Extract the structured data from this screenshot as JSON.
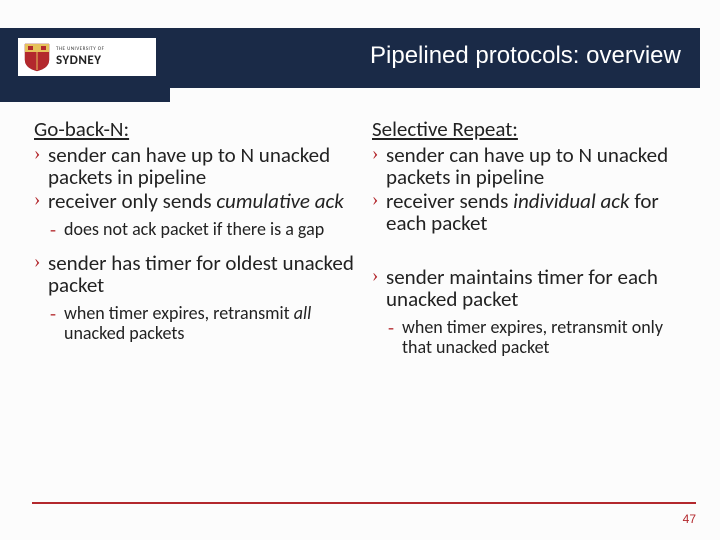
{
  "logo": {
    "top_text": "THE UNIVERSITY OF",
    "name": "SYDNEY"
  },
  "title": "Pipelined protocols: overview",
  "left": {
    "heading": "Go-back-N:",
    "b1_a": "sender can have up to N unacked packets in pipeline",
    "b2_a": "receiver only sends ",
    "b2_b": "cumulative ack",
    "s1": "does not ack packet if there is a gap",
    "b3": "sender has timer for oldest unacked packet",
    "s2_a": "when timer expires, retransmit ",
    "s2_b": "all",
    "s2_c": " unacked packets"
  },
  "right": {
    "heading": "Selective Repeat:",
    "b1": "sender can have up to N unacked packets in pipeline",
    "b2_a": "receiver sends ",
    "b2_b": "individual ack",
    "b2_c": " for each packet",
    "b3": "sender maintains timer for each unacked packet",
    "s1": "when timer expires, retransmit only that unacked packet"
  },
  "page": "47"
}
